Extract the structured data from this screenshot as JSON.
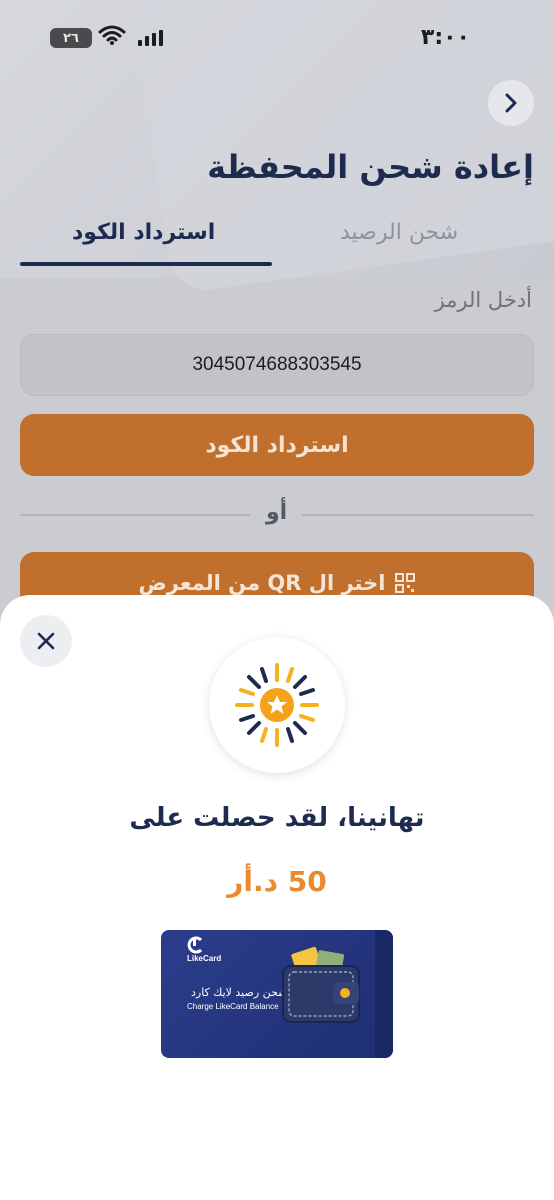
{
  "status_bar": {
    "time": "٣:٠٠",
    "battery": "٢٦"
  },
  "page": {
    "title": "إعادة شحن المحفظة"
  },
  "tabs": [
    {
      "label": "شحن الرصيد",
      "active": false
    },
    {
      "label": "استرداد الكود",
      "active": true
    }
  ],
  "redeem": {
    "field_label": "أدخل الرمز",
    "code_value": "3045074688303545",
    "redeem_button": "استرداد الكود",
    "or_text": "أو",
    "qr_button": "اختر ال QR من المعرض"
  },
  "dialog": {
    "congrats_text": "تهانينا، لقد حصلت على",
    "amount_text": "50 د.أر",
    "card": {
      "brand": "LikeCard",
      "arabic_label": "شحن رصيد لايك كارد",
      "english_label": "Charge LikeCard Balance"
    }
  },
  "colors": {
    "primary_navy": "#1d2b4f",
    "accent_orange": "#ea8a2f",
    "button_orange_dimmed": "#c0702c"
  }
}
